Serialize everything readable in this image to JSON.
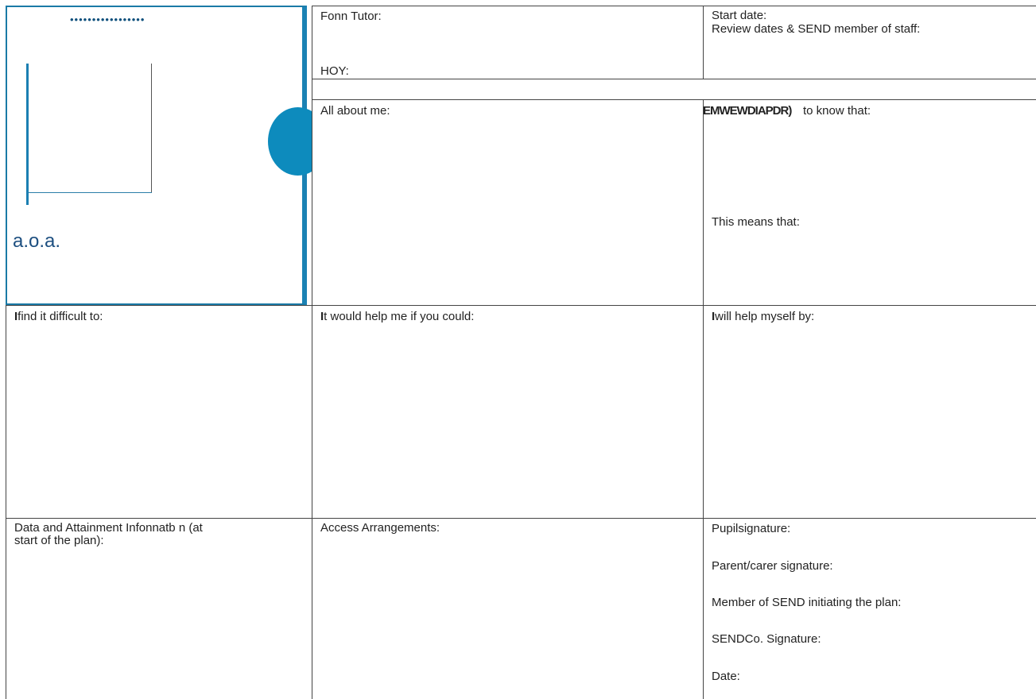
{
  "photo_panel": {
    "dots": "•••••••••••••••••",
    "caption": "a.o.a."
  },
  "header": {
    "form_tutor": "Fonn Tutor:",
    "hoy": "HOY:",
    "start_date": "Start date:",
    "review_dates": "Review dates & SEND member of staff:"
  },
  "row1": {
    "all_about_me": "All about me:",
    "need_to_know_overlap": "EMWEWDIAPDR)",
    "need_to_know": "to know  that:",
    "this_means": "This means  that:"
  },
  "row2": {
    "find_difficult": "find it difficult to:",
    "find_difficult_i": "I",
    "help_me": "t would help me if you could:",
    "help_me_i": "I",
    "help_myself": "will help myself  by:",
    "help_myself_i": "I"
  },
  "row3": {
    "data_line1": "Data and Attainment Infonnatb n (at",
    "data_line2": "start of the plan):",
    "access": "Access Arrangements:",
    "pupil_sig": "Pupilsignature:",
    "parent_sig": "Parent/carer signature:",
    "member_send": "Member of SEND initiating the plan:",
    "sendco_sig": "SENDCo. Signature:",
    "date": "Date:"
  }
}
